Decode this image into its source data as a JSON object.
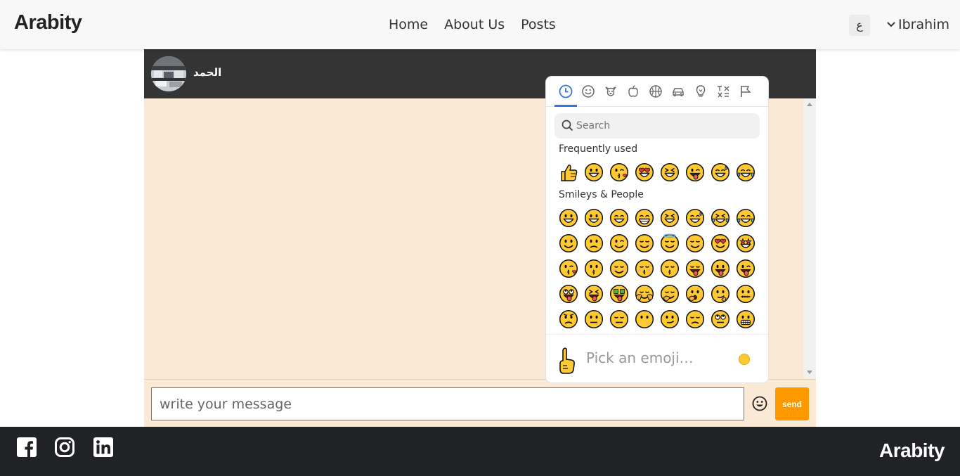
{
  "navbar": {
    "brand": "Arabity",
    "links": [
      "Home",
      "About Us",
      "Posts"
    ],
    "lang_button": "ع",
    "user_name": "Ibrahim"
  },
  "chat": {
    "contact_name": "الحمد",
    "input_placeholder": "write your message",
    "send_label": "send"
  },
  "emoji_picker": {
    "search_placeholder": "Search",
    "sections": [
      "Frequently used",
      "Smileys & People"
    ],
    "preview_text": "Pick an emoji…",
    "tab_icons": [
      "clock-icon",
      "smiley-icon",
      "animal-icon",
      "food-icon",
      "activity-icon",
      "travel-icon",
      "objects-icon",
      "symbols-icon",
      "flags-icon"
    ]
  },
  "footer": {
    "brand": "Arabity",
    "social_icons": [
      "facebook-icon",
      "instagram-icon",
      "linkedin-icon"
    ]
  },
  "colors": {
    "accent": "#ff9900",
    "chat_bg": "#fae9d4",
    "header_dark": "#343434",
    "footer_bg": "#212226",
    "picker_active": "#3773e0"
  }
}
